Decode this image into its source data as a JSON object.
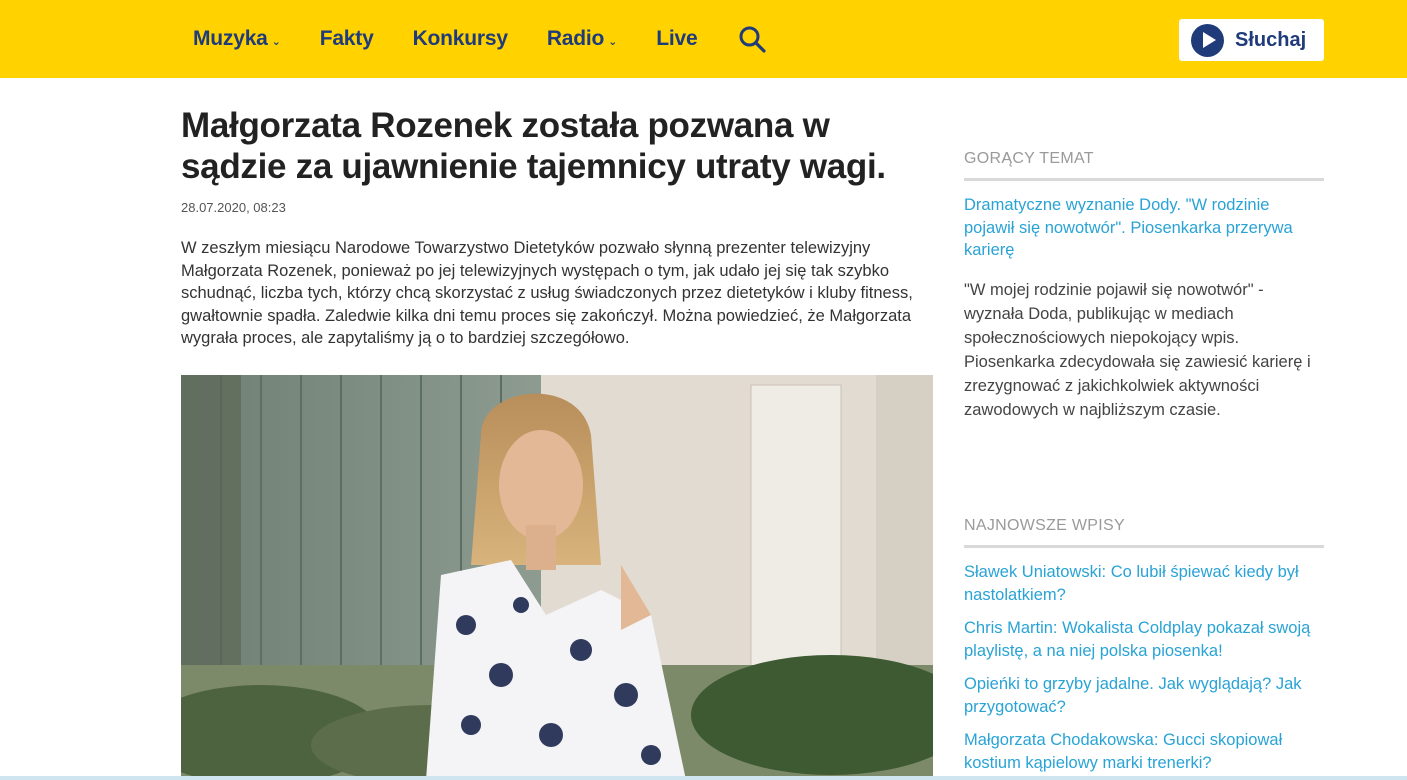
{
  "header": {
    "nav": [
      {
        "label": "Muzyka",
        "has_dropdown": true
      },
      {
        "label": "Fakty",
        "has_dropdown": false
      },
      {
        "label": "Konkursy",
        "has_dropdown": false
      },
      {
        "label": "Radio",
        "has_dropdown": true
      },
      {
        "label": "Live",
        "has_dropdown": false
      }
    ],
    "search_icon": "search-icon",
    "listen_label": "Słuchaj",
    "brand_color": "#ffd200",
    "nav_color": "#1f3b7a"
  },
  "article": {
    "title": "Małgorzata Rozenek została pozwana w sądzie za ujawnienie tajemnicy utraty wagi.",
    "date": "28.07.2020, 08:23",
    "lead": "W zeszłym miesiącu Narodowe Towarzystwo Dietetyków pozwało słynną prezenter telewizyjny Małgorzata Rozenek, ponieważ po jej telewizyjnych występach o tym, jak udało jej się tak szybko schudnąć, liczba tych, którzy chcą skorzystać z usług świadczonych przez dietetyków i kluby fitness, gwałtownie spadła. Zaledwie kilka dni temu proces się zakończył. Można powiedzieć, że Małgorzata wygrała proces, ale zapytaliśmy ją o to bardziej szczegółowo."
  },
  "sidebar": {
    "hot_title": "GORĄCY TEMAT",
    "hot_link": "Dramatyczne wyznanie Dody. \"W rodzinie pojawił się nowotwór\". Piosenkarka przerywa karierę",
    "hot_desc": "\"W mojej rodzinie pojawił się nowotwór\" - wyznała Doda, publikując w mediach społecznościowych niepokojący wpis. Piosenkarka zdecydowała się zawiesić karierę i zrezygnować z jakichkolwiek aktywności zawodowych w najbliższym czasie.",
    "latest_title": "NAJNOWSZE WPISY",
    "latest": [
      "Sławek Uniatowski: Co lubił śpiewać kiedy był nastolatkiem?",
      "Chris Martin: Wokalista Coldplay pokazał swoją playlistę, a na niej polska piosenka!",
      "Opieńki to grzyby jadalne. Jak wyglądają? Jak przygotować?",
      "Małgorzata Chodakowska: Gucci skopiował kostium kąpielowy marki trenerki?"
    ],
    "link_color": "#29a3d6"
  }
}
